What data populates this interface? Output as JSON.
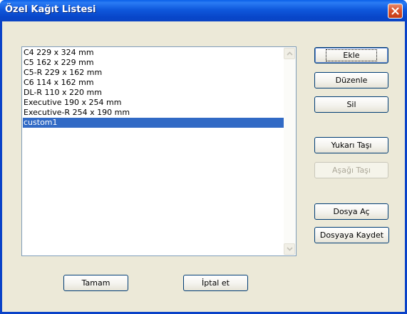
{
  "window": {
    "title": "Özel Kağıt Listesi",
    "close_icon": "close-icon"
  },
  "paper_list": {
    "items": [
      "C4 229 x 324 mm",
      "C5 162 x 229 mm",
      "C5-R 229 x 162 mm",
      "C6 114 x 162 mm",
      "DL-R 110 x 220 mm",
      "Executive 190 x 254 mm",
      "Executive-R 254 x 190 mm",
      "custom1"
    ],
    "selected_index": 7
  },
  "buttons": {
    "add": "Ekle",
    "edit": "Düzenle",
    "delete": "Sil",
    "move_up": "Yukarı Taşı",
    "move_down": "Aşağı Taşı",
    "open_file": "Dosya Aç",
    "save_file": "Dosyaya Kaydet",
    "ok": "Tamam",
    "cancel": "İptal et"
  },
  "colors": {
    "titlebar": "#0a5fe8",
    "selection": "#316ac5",
    "dialog_bg": "#ece9d8",
    "close_button": "#d9522c"
  }
}
